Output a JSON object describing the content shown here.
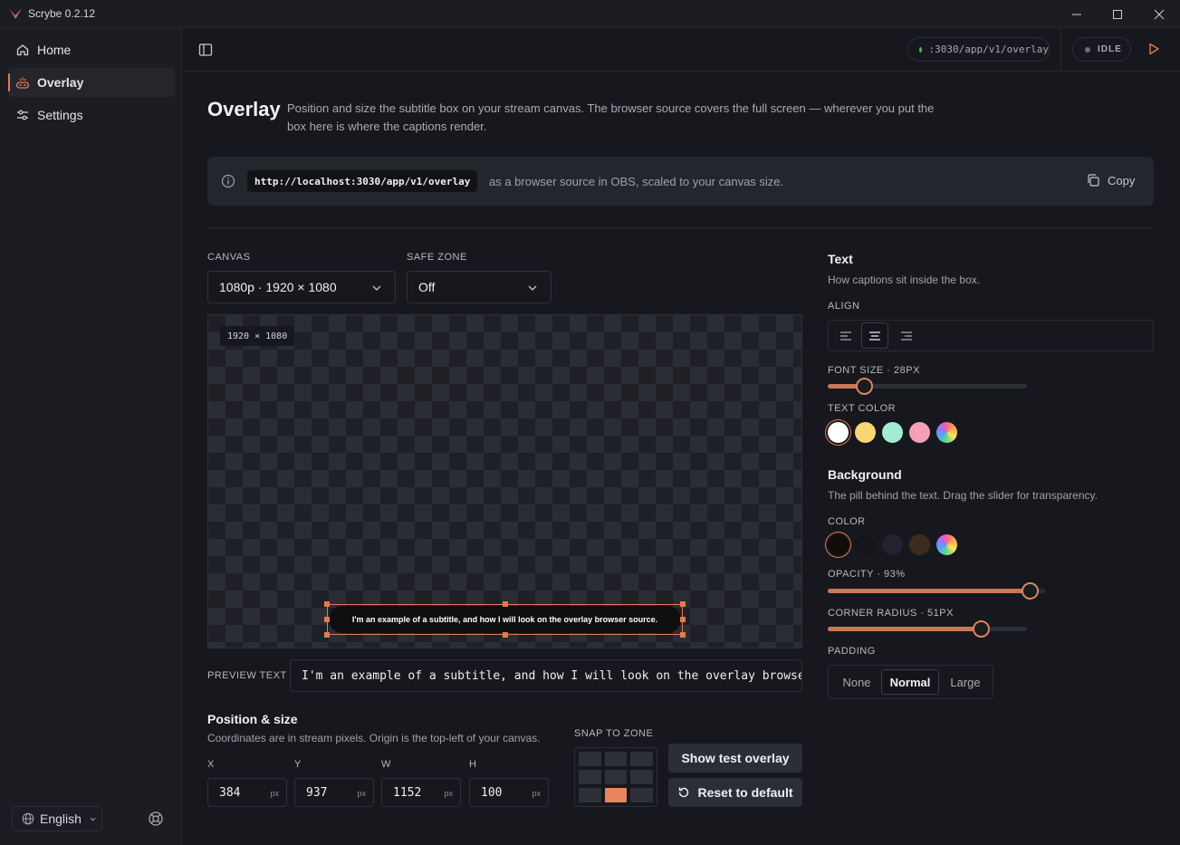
{
  "window": {
    "title": "Scrybe 0.2.12"
  },
  "sidebar": {
    "items": [
      {
        "label": "Home",
        "icon": "home-icon"
      },
      {
        "label": "Overlay",
        "icon": "overlay-icon",
        "active": true
      },
      {
        "label": "Settings",
        "icon": "sliders-icon"
      }
    ],
    "language": "English"
  },
  "topbar": {
    "url": ":3030/app/v1/overlay",
    "url_status_color": "#3fb950",
    "status": "IDLE",
    "status_color": "#6e7076"
  },
  "page": {
    "title": "Overlay",
    "description": "Position and size the subtitle box on your stream canvas. The browser source covers the full screen — wherever you put the box here is where the captions render.",
    "info": {
      "url": "http://localhost:3030/app/v1/overlay",
      "text": "as a browser source in OBS, scaled to your canvas size.",
      "copy_label": "Copy"
    }
  },
  "canvas": {
    "label": "CANVAS",
    "value": "1080p · 1920 × 1080",
    "safe_zone_label": "SAFE ZONE",
    "safe_zone_value": "Off",
    "badge": "1920 × 1080",
    "subtitle_text": "I'm an example of a subtitle, and how I will look on the overlay browser source."
  },
  "preview": {
    "label": "PREVIEW TEXT",
    "value": "I'm an example of a subtitle, and how I will look on the overlay browser source."
  },
  "position": {
    "title": "Position & size",
    "subtitle": "Coordinates are in stream pixels. Origin is the top-left of your canvas.",
    "fields": [
      {
        "label": "X",
        "value": "384",
        "unit": "px"
      },
      {
        "label": "Y",
        "value": "937",
        "unit": "px"
      },
      {
        "label": "W",
        "value": "1152",
        "unit": "px"
      },
      {
        "label": "H",
        "value": "100",
        "unit": "px"
      }
    ],
    "snap_label": "SNAP TO ZONE",
    "snap_selected": "bottom-center",
    "show_test_label": "Show test overlay",
    "reset_label": "Reset to default"
  },
  "text_panel": {
    "title": "Text",
    "subtitle": "How captions sit inside the box.",
    "align_label": "ALIGN",
    "align_selected": "center",
    "font_size_label": "FONT SIZE · 28PX",
    "font_size_fraction": 0.18,
    "color_label": "TEXT COLOR",
    "colors": [
      "#ffffff",
      "#f7d774",
      "#a4ecd0",
      "#f5a0b4",
      "rainbow"
    ],
    "selected_color": "#ffffff"
  },
  "background_panel": {
    "title": "Background",
    "subtitle": "The pill behind the text. Drag the slider for transparency.",
    "color_label": "COLOR",
    "colors": [
      "#130d0a",
      "#141519",
      "#23222e",
      "#3b2c1e",
      "rainbow"
    ],
    "selected_color": "#130d0a",
    "opacity_label": "OPACITY · 93%",
    "opacity_fraction": 0.93,
    "radius_label": "CORNER RADIUS · 51PX",
    "radius_fraction": 0.77,
    "padding_label": "PADDING",
    "padding_options": [
      "None",
      "Normal",
      "Large"
    ],
    "padding_selected": "Normal"
  },
  "accent_color": "#e07b54"
}
